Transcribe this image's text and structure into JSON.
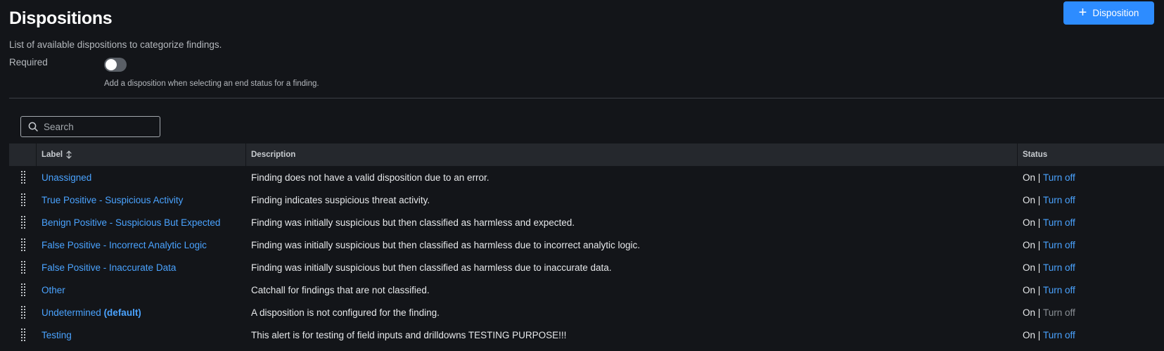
{
  "page": {
    "title": "Dispositions",
    "subtitle": "List of available dispositions to categorize findings.",
    "required_label": "Required",
    "required_help": "Add a disposition when selecting an end status for a finding.",
    "required_toggle_on": false,
    "add_button_label": "Disposition"
  },
  "search": {
    "placeholder": "Search",
    "value": ""
  },
  "table": {
    "columns": {
      "label": "Label",
      "description": "Description",
      "status": "Status"
    },
    "rows": [
      {
        "label": "Unassigned",
        "suffix": "",
        "description": "Finding does not have a valid disposition due to an error.",
        "status": "On",
        "action": "Turn off",
        "action_enabled": true
      },
      {
        "label": "True Positive - Suspicious Activity",
        "suffix": "",
        "description": "Finding indicates suspicious threat activity.",
        "status": "On",
        "action": "Turn off",
        "action_enabled": true
      },
      {
        "label": "Benign Positive - Suspicious But Expected",
        "suffix": "",
        "description": "Finding was initially suspicious but then classified as harmless and expected.",
        "status": "On",
        "action": "Turn off",
        "action_enabled": true
      },
      {
        "label": "False Positive - Incorrect Analytic Logic",
        "suffix": "",
        "description": "Finding was initially suspicious but then classified as harmless due to incorrect analytic logic.",
        "status": "On",
        "action": "Turn off",
        "action_enabled": true
      },
      {
        "label": "False Positive - Inaccurate Data",
        "suffix": "",
        "description": "Finding was initially suspicious but then classified as harmless due to inaccurate data.",
        "status": "On",
        "action": "Turn off",
        "action_enabled": true
      },
      {
        "label": "Other",
        "suffix": "",
        "description": "Catchall for findings that are not classified.",
        "status": "On",
        "action": "Turn off",
        "action_enabled": true
      },
      {
        "label": "Undetermined",
        "suffix": "(default)",
        "description": "A disposition is not configured for the finding.",
        "status": "On",
        "action": "Turn off",
        "action_enabled": false
      },
      {
        "label": "Testing",
        "suffix": "",
        "description": "This alert is for testing of field inputs and drilldowns TESTING PURPOSE!!!",
        "status": "On",
        "action": "Turn off",
        "action_enabled": true
      }
    ]
  },
  "colors": {
    "accent": "#2d8cff",
    "link": "#4aa3ff",
    "background": "#131519",
    "header": "#25282d"
  },
  "icons": {
    "add": "plus-icon",
    "search": "search-icon",
    "sort": "sort-icon",
    "drag": "drag-handle-icon"
  }
}
